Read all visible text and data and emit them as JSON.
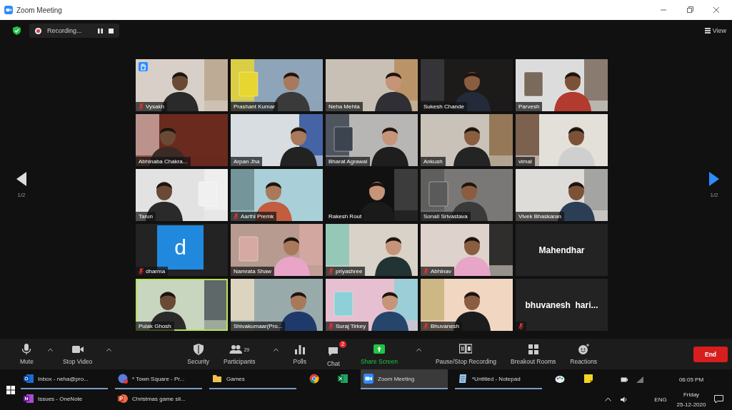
{
  "window": {
    "title": "Zoom Meeting"
  },
  "meeting_bar": {
    "recording_label": "Recording...",
    "view_label": "View"
  },
  "pager": {
    "left_label": "1/2",
    "right_label": "1/2"
  },
  "tiles": [
    {
      "kind": "video",
      "name": "Vysakh",
      "muted": true,
      "hand_raised": true,
      "active_speaker": false
    },
    {
      "kind": "video",
      "name": "Prashant Kumar",
      "muted": false,
      "hand_raised": false,
      "active_speaker": false
    },
    {
      "kind": "video",
      "name": "Neha Mehta",
      "muted": false,
      "hand_raised": false,
      "active_speaker": false
    },
    {
      "kind": "video",
      "name": "Sukesh Chande",
      "muted": false,
      "hand_raised": false,
      "active_speaker": false
    },
    {
      "kind": "video",
      "name": "Parvesh",
      "muted": false,
      "hand_raised": false,
      "active_speaker": false
    },
    {
      "kind": "video",
      "name": "Abhinaba Chakra...",
      "muted": false,
      "hand_raised": false,
      "active_speaker": false
    },
    {
      "kind": "video",
      "name": "Arpan Jha",
      "muted": false,
      "hand_raised": false,
      "active_speaker": false
    },
    {
      "kind": "video",
      "name": "Bharat Agrawal",
      "muted": false,
      "hand_raised": false,
      "active_speaker": false
    },
    {
      "kind": "video",
      "name": "Ankush",
      "muted": false,
      "hand_raised": false,
      "active_speaker": false
    },
    {
      "kind": "video",
      "name": "vimal",
      "muted": false,
      "hand_raised": false,
      "active_speaker": false
    },
    {
      "kind": "video",
      "name": "Tarun",
      "muted": false,
      "hand_raised": false,
      "active_speaker": false
    },
    {
      "kind": "video",
      "name": "Aarthi Premk",
      "muted": true,
      "hand_raised": false,
      "active_speaker": false
    },
    {
      "kind": "video",
      "name": "Rakesh Rout",
      "muted": false,
      "hand_raised": false,
      "active_speaker": false
    },
    {
      "kind": "video",
      "name": "Sonali Srivastava",
      "muted": false,
      "hand_raised": false,
      "active_speaker": false
    },
    {
      "kind": "video",
      "name": "Vivek Bhaskaran",
      "muted": false,
      "hand_raised": false,
      "active_speaker": false
    },
    {
      "kind": "avatar",
      "name": "dharma",
      "avatar_letter": "d",
      "muted": true,
      "hand_raised": false,
      "active_speaker": false
    },
    {
      "kind": "video",
      "name": "Namrata Shaw",
      "muted": false,
      "hand_raised": false,
      "active_speaker": false
    },
    {
      "kind": "video",
      "name": "priyashree",
      "muted": true,
      "hand_raised": false,
      "active_speaker": false
    },
    {
      "kind": "video",
      "name": "Abhinav",
      "muted": true,
      "hand_raised": false,
      "active_speaker": false
    },
    {
      "kind": "nameonly",
      "name": "Mahendhar",
      "muted": false,
      "hand_raised": false,
      "active_speaker": false
    },
    {
      "kind": "video",
      "name": "Pulak Ghosh",
      "muted": false,
      "hand_raised": false,
      "active_speaker": true
    },
    {
      "kind": "video",
      "name": "Shivakumaar(Pro...",
      "muted": false,
      "hand_raised": false,
      "active_speaker": false
    },
    {
      "kind": "video",
      "name": "Suraj Tirkey",
      "muted": true,
      "hand_raised": false,
      "active_speaker": false
    },
    {
      "kind": "video",
      "name": "Bhuvanesh",
      "muted": true,
      "hand_raised": false,
      "active_speaker": false
    },
    {
      "kind": "nameonly",
      "name": "bhuvanesh  hari...",
      "muted": true,
      "hand_raised": false,
      "active_speaker": false
    }
  ],
  "toolbar": {
    "left": [
      {
        "kind": "mic",
        "label": "Mute",
        "has_menu": true
      },
      {
        "kind": "camera",
        "label": "Stop Video",
        "has_menu": true
      }
    ],
    "center": [
      {
        "kind": "shield",
        "label": "Security",
        "has_menu": false
      },
      {
        "kind": "participants",
        "label": "Participants",
        "count": "29",
        "has_menu": true
      },
      {
        "kind": "polls",
        "label": "Polls",
        "has_menu": false
      },
      {
        "kind": "chat",
        "label": "Chat",
        "badge": "2",
        "has_menu": false
      },
      {
        "kind": "share",
        "label": "Share Screen",
        "highlighted": true,
        "has_menu": true
      },
      {
        "kind": "recording",
        "label": "Pause/Stop Recording",
        "has_menu": false
      },
      {
        "kind": "breakout",
        "label": "Breakout Rooms",
        "has_menu": false
      },
      {
        "kind": "reactions",
        "label": "Reactions",
        "has_menu": false
      }
    ],
    "end_label": "End"
  },
  "taskbar": {
    "rows": [
      [
        {
          "kind": "outlook",
          "label": "Inbox - neha@pro...",
          "open": true,
          "selected": false
        },
        {
          "kind": "teams",
          "label": "* Town Square - Pr...",
          "open": true,
          "selected": false
        },
        {
          "kind": "folder",
          "label": "Games",
          "open": true,
          "selected": false
        },
        {
          "kind": "chrome",
          "open": false,
          "selected": false
        },
        {
          "kind": "excel",
          "open": false,
          "selected": false
        },
        {
          "kind": "zoom",
          "label": "Zoom Meeting",
          "open": true,
          "selected": true
        },
        {
          "kind": "notepad",
          "label": "*Untitled - Notepad",
          "open": true,
          "selected": false
        },
        {
          "kind": "paint",
          "open": false,
          "selected": false
        },
        {
          "kind": "sticky",
          "open": false,
          "selected": false
        }
      ],
      [
        {
          "kind": "onenote",
          "label": "Issues - OneNote",
          "open": false,
          "selected": false
        },
        {
          "kind": "powerpoint",
          "label": "Christmas game sli...",
          "open": false,
          "selected": false
        }
      ]
    ],
    "language": "ENG",
    "time": "06:05 PM",
    "day": "Friday",
    "date": "25-12-2020"
  }
}
